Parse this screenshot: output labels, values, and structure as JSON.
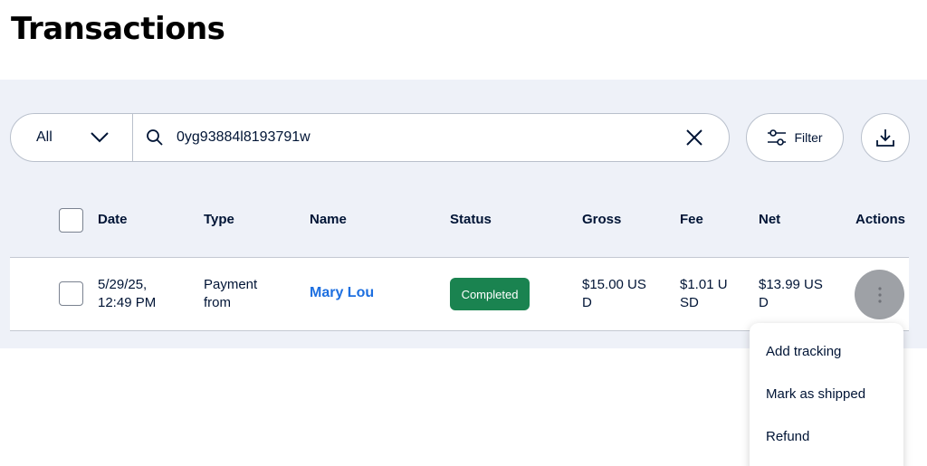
{
  "page": {
    "title": "Transactions"
  },
  "toolbar": {
    "type_filter": "All",
    "search_value": "0yg93884l8193791w",
    "filter_label": "Filter"
  },
  "table": {
    "headers": [
      "Date",
      "Type",
      "Name",
      "Status",
      "Gross",
      "Fee",
      "Net",
      "Actions"
    ],
    "rows": [
      {
        "date_line1": "5/29/25,",
        "date_line2": "12:49 PM",
        "type_line1": "Payment",
        "type_line2": "from",
        "name": "Mary Lou",
        "status": "Completed",
        "gross_line1": "$15.00 US",
        "gross_line2": "D",
        "fee_line1": "$1.01 U",
        "fee_line2": "SD",
        "net_line1": "$13.99 US",
        "net_line2": "D"
      }
    ]
  },
  "actions_menu": {
    "items": [
      "Add tracking",
      "Mark as shipped",
      "Refund"
    ]
  },
  "colors": {
    "status_completed": "#1a8350",
    "link": "#1d6fe0",
    "panel_bg": "#eef1f8"
  },
  "icons": [
    "chevron-down-icon",
    "search-icon",
    "close-icon",
    "sliders-icon",
    "download-icon",
    "more-vertical-icon"
  ]
}
